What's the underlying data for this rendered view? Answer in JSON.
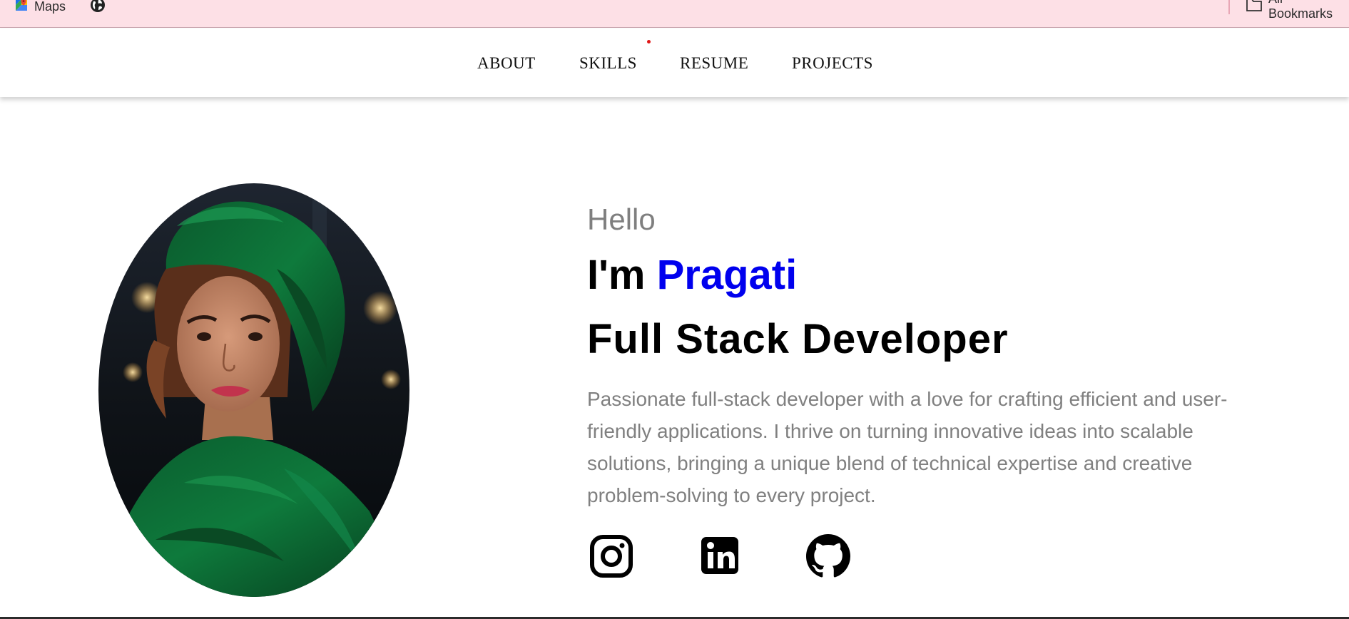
{
  "bookmarks": {
    "maps_label": "Maps",
    "all_bookmarks_label": "All Bookmarks",
    "icons": [
      "maps-icon",
      "globe-icon",
      "folder-icon"
    ]
  },
  "nav": {
    "items": [
      {
        "label": "ABOUT"
      },
      {
        "label": "SKILLS"
      },
      {
        "label": "RESUME"
      },
      {
        "label": "PROJECTS"
      }
    ],
    "indicator_color": "#e01616"
  },
  "hero": {
    "hello": "Hello",
    "im": "I'm ",
    "name": "Pragati",
    "role": "Full Stack Developer",
    "bio": "Passionate full-stack developer with a love for crafting efficient and user-friendly applications. I thrive on turning innovative ideas into scalable solutions, bringing a unique blend of technical expertise and creative problem-solving to every project.",
    "name_color": "#0000ee",
    "social_icons": [
      "instagram-icon",
      "linkedin-icon",
      "github-icon"
    ]
  },
  "colors": {
    "bookmarks_bg": "#fde0e6",
    "muted_text": "#808080"
  }
}
